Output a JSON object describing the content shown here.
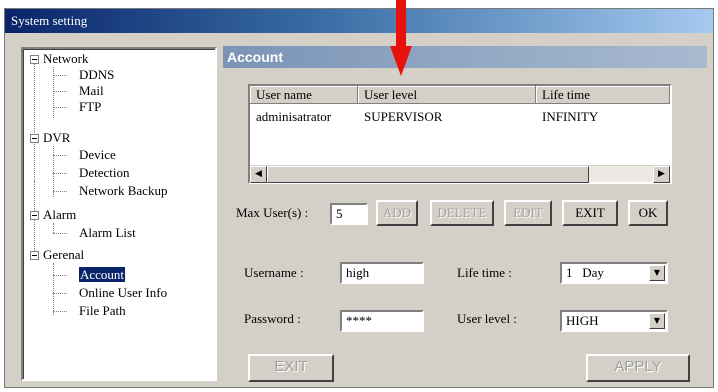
{
  "window": {
    "title": "System setting"
  },
  "tree": {
    "groups": [
      {
        "label": "Network",
        "children": [
          "DDNS",
          "Mail",
          "FTP"
        ]
      },
      {
        "label": "DVR",
        "children": [
          "Device",
          "Detection",
          "Network Backup"
        ]
      },
      {
        "label": "Alarm",
        "children": [
          "Alarm List"
        ]
      },
      {
        "label": "Gerenal",
        "children": [
          "Account",
          "Online User Info",
          "File Path"
        ]
      }
    ],
    "selected": "Account"
  },
  "panel": {
    "title": "Account"
  },
  "user_table": {
    "columns": [
      "User name",
      "User level",
      "Life time"
    ],
    "rows": [
      [
        "adminisatrator",
        "SUPERVISOR",
        "INFINITY"
      ]
    ]
  },
  "max_users": {
    "label": "Max User(s) :",
    "value": "5"
  },
  "buttons": {
    "add": "ADD",
    "delete": "DELETE",
    "edit": "EDIT",
    "exit_top": "EXIT",
    "ok": "OK",
    "exit_bottom": "EXIT",
    "apply": "APPLY"
  },
  "form": {
    "username_label": "Username :",
    "username_value": "high",
    "password_label": "Password :",
    "password_value": "****",
    "lifetime_label": "Life time :",
    "lifetime_value": "1   Day",
    "userlevel_label": "User level :",
    "userlevel_value": "HIGH"
  },
  "colors": {
    "annotation_arrow": "#e8120c",
    "selection": "#0a246a",
    "panel_header": "#7b94b6"
  }
}
